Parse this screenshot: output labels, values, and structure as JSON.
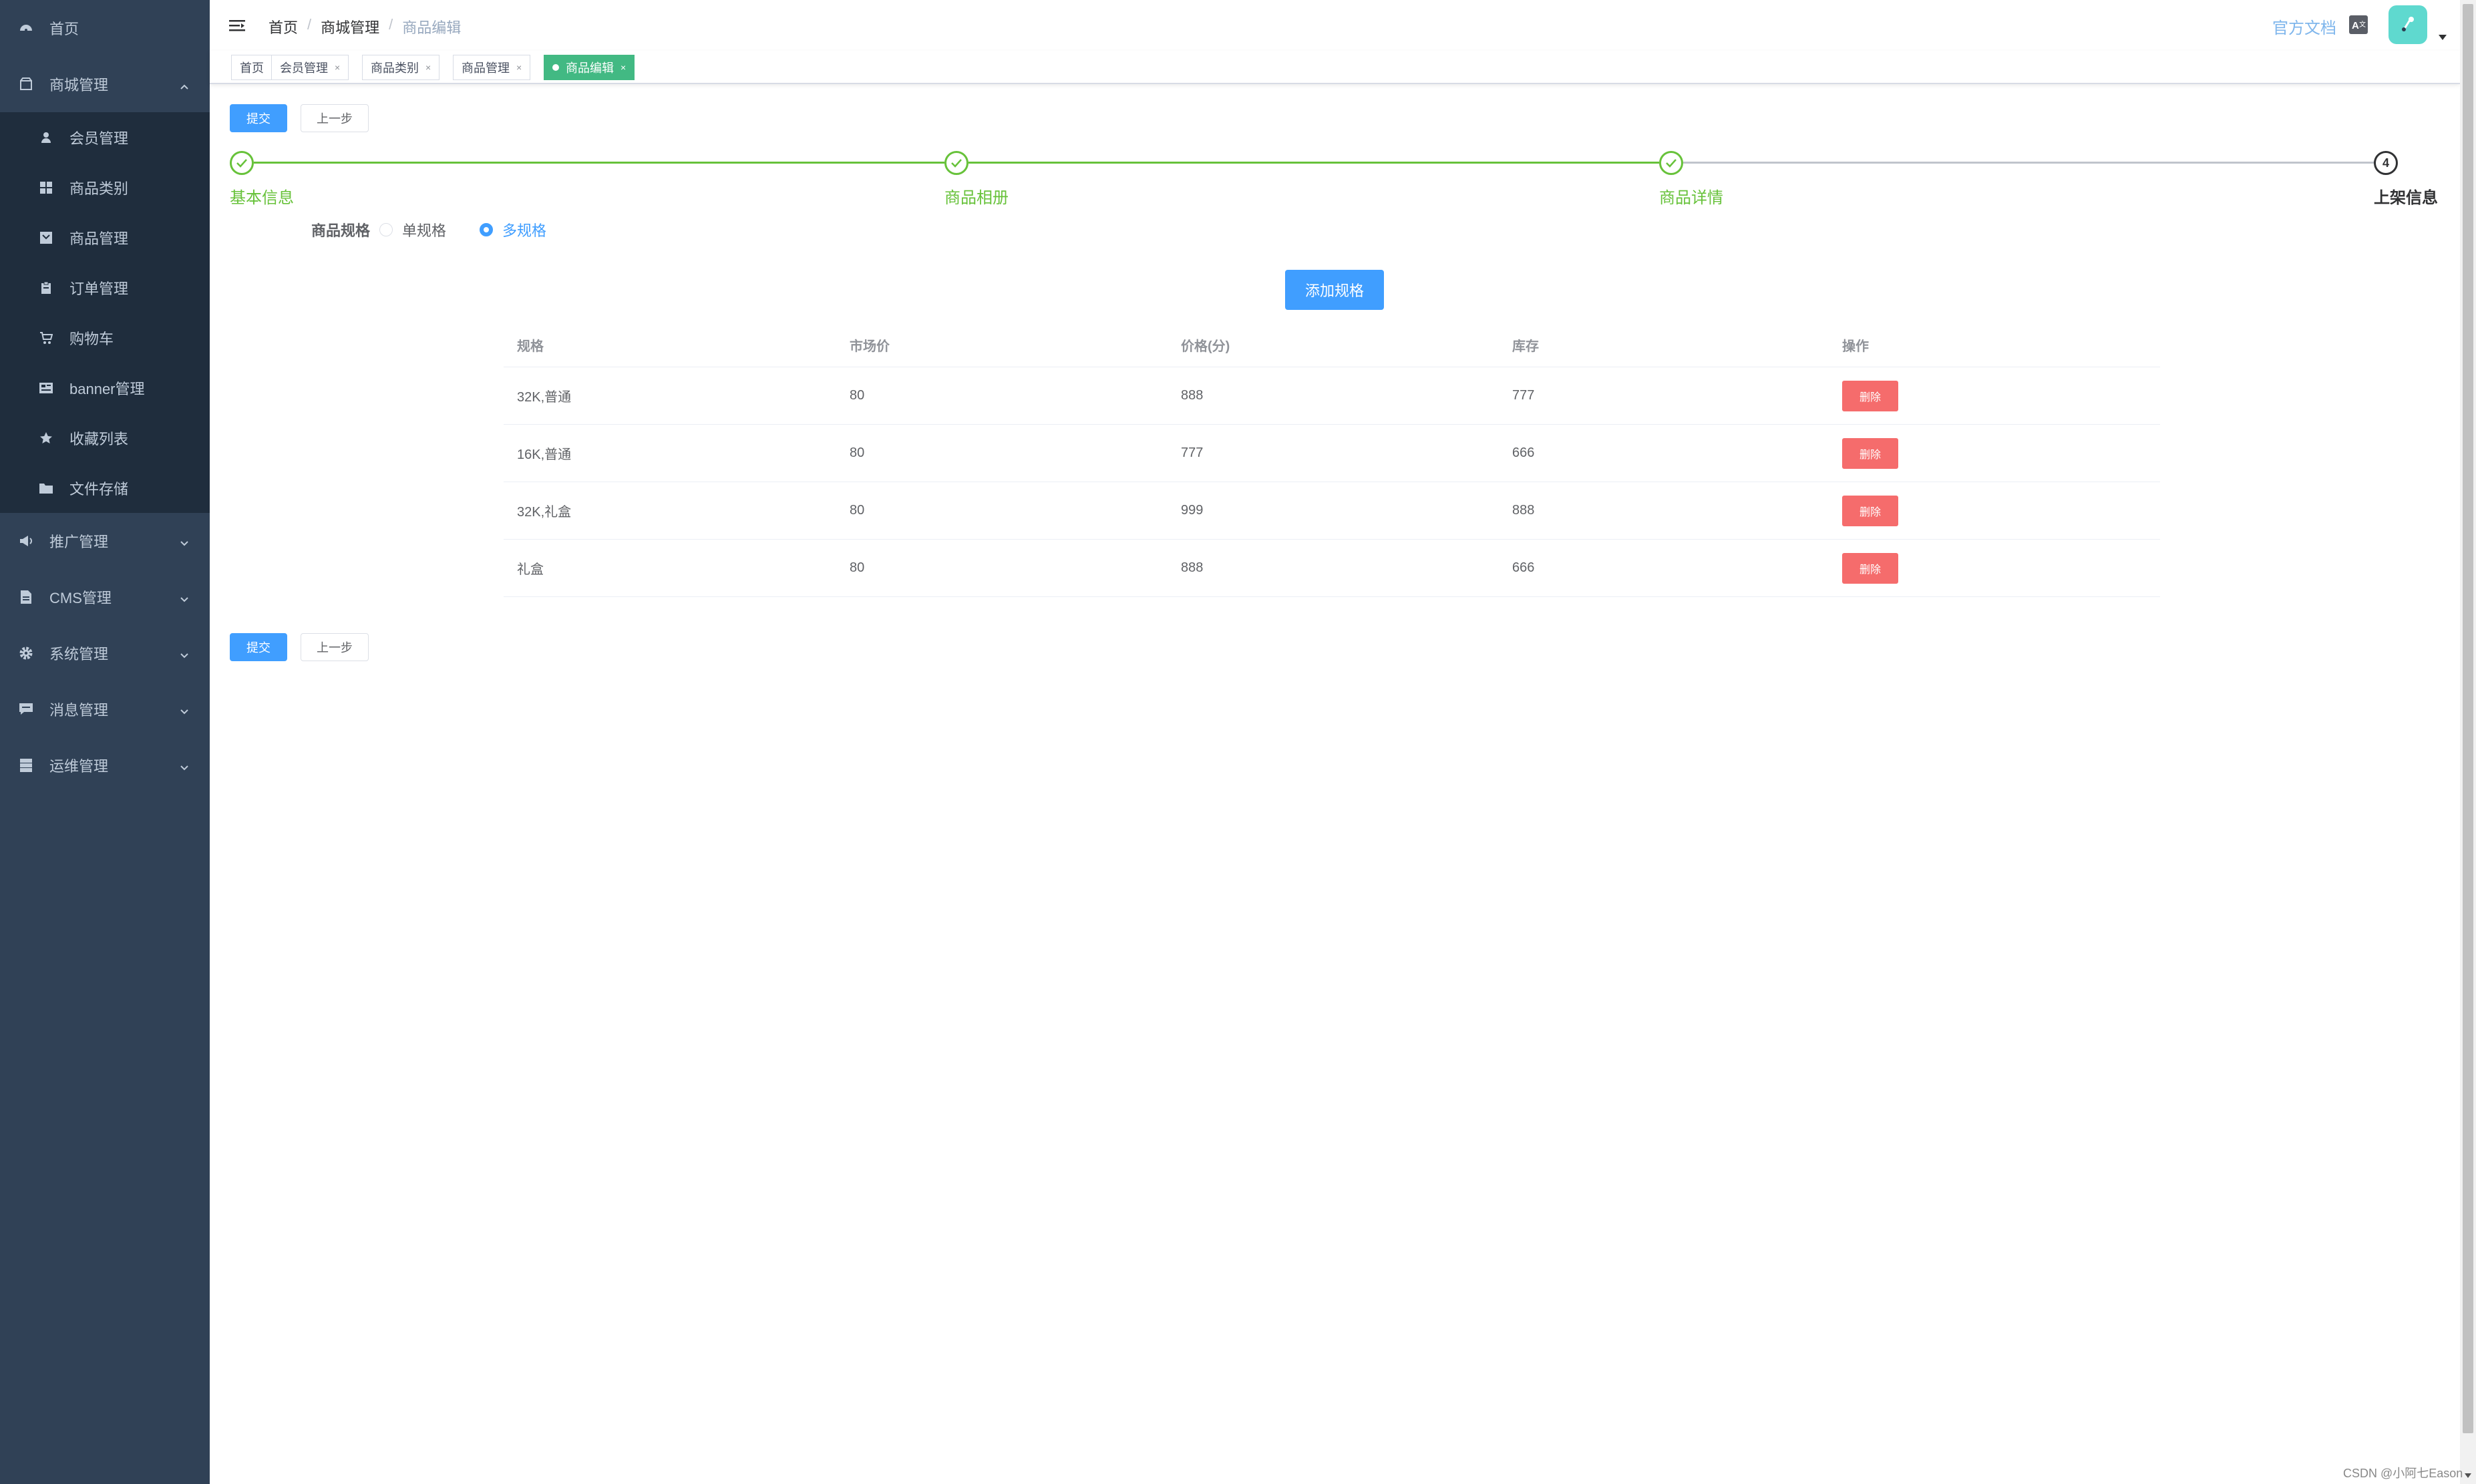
{
  "sidebar": {
    "items": [
      {
        "label": "首页",
        "icon": "dashboard-icon"
      },
      {
        "label": "商城管理",
        "icon": "shop-icon",
        "expanded": true
      },
      {
        "label": "推广管理",
        "icon": "promotion-icon"
      },
      {
        "label": "CMS管理",
        "icon": "document-icon"
      },
      {
        "label": "系统管理",
        "icon": "gear-icon"
      },
      {
        "label": "消息管理",
        "icon": "message-icon"
      },
      {
        "label": "运维管理",
        "icon": "server-icon"
      }
    ],
    "sub_items": [
      {
        "label": "会员管理",
        "icon": "user-icon"
      },
      {
        "label": "商品类别",
        "icon": "grid-icon"
      },
      {
        "label": "商品管理",
        "icon": "goods-icon"
      },
      {
        "label": "订单管理",
        "icon": "clipboard-icon"
      },
      {
        "label": "购物车",
        "icon": "cart-icon"
      },
      {
        "label": "banner管理",
        "icon": "banner-icon"
      },
      {
        "label": "收藏列表",
        "icon": "star-icon"
      },
      {
        "label": "文件存储",
        "icon": "folder-icon"
      }
    ]
  },
  "header": {
    "breadcrumb": [
      "首页",
      "商城管理",
      "商品编辑"
    ],
    "doc_link": "官方文档"
  },
  "tags": [
    "首页",
    "会员管理",
    "商品类别",
    "商品管理",
    "商品编辑"
  ],
  "actions": {
    "submit": "提交",
    "prev": "上一步"
  },
  "steps": [
    {
      "title": "基本信息",
      "status": "finish"
    },
    {
      "title": "商品相册",
      "status": "finish"
    },
    {
      "title": "商品详情",
      "status": "finish"
    },
    {
      "title": "上架信息",
      "status": "process",
      "number": "4"
    }
  ],
  "spec": {
    "label": "商品规格",
    "options": [
      "单规格",
      "多规格"
    ],
    "selected": "多规格",
    "add_button": "添加规格"
  },
  "table": {
    "headers": [
      "规格",
      "市场价",
      "价格(分)",
      "库存",
      "操作"
    ],
    "rows": [
      {
        "spec": "32K,普通",
        "market_price": "80",
        "price": "888",
        "stock": "777",
        "action": "删除"
      },
      {
        "spec": "16K,普通",
        "market_price": "80",
        "price": "777",
        "stock": "666",
        "action": "删除"
      },
      {
        "spec": "32K,礼盒",
        "market_price": "80",
        "price": "999",
        "stock": "888",
        "action": "删除"
      },
      {
        "spec": "礼盒",
        "market_price": "80",
        "price": "888",
        "stock": "666",
        "action": "删除"
      }
    ]
  },
  "watermark": "CSDN @小阿七Eason",
  "colors": {
    "sidebar_bg": "#304156",
    "submenu_bg": "#1f2d3d",
    "primary": "#409eff",
    "success": "#67c23a",
    "danger": "#f56c6c",
    "active_tag": "#42b983"
  }
}
